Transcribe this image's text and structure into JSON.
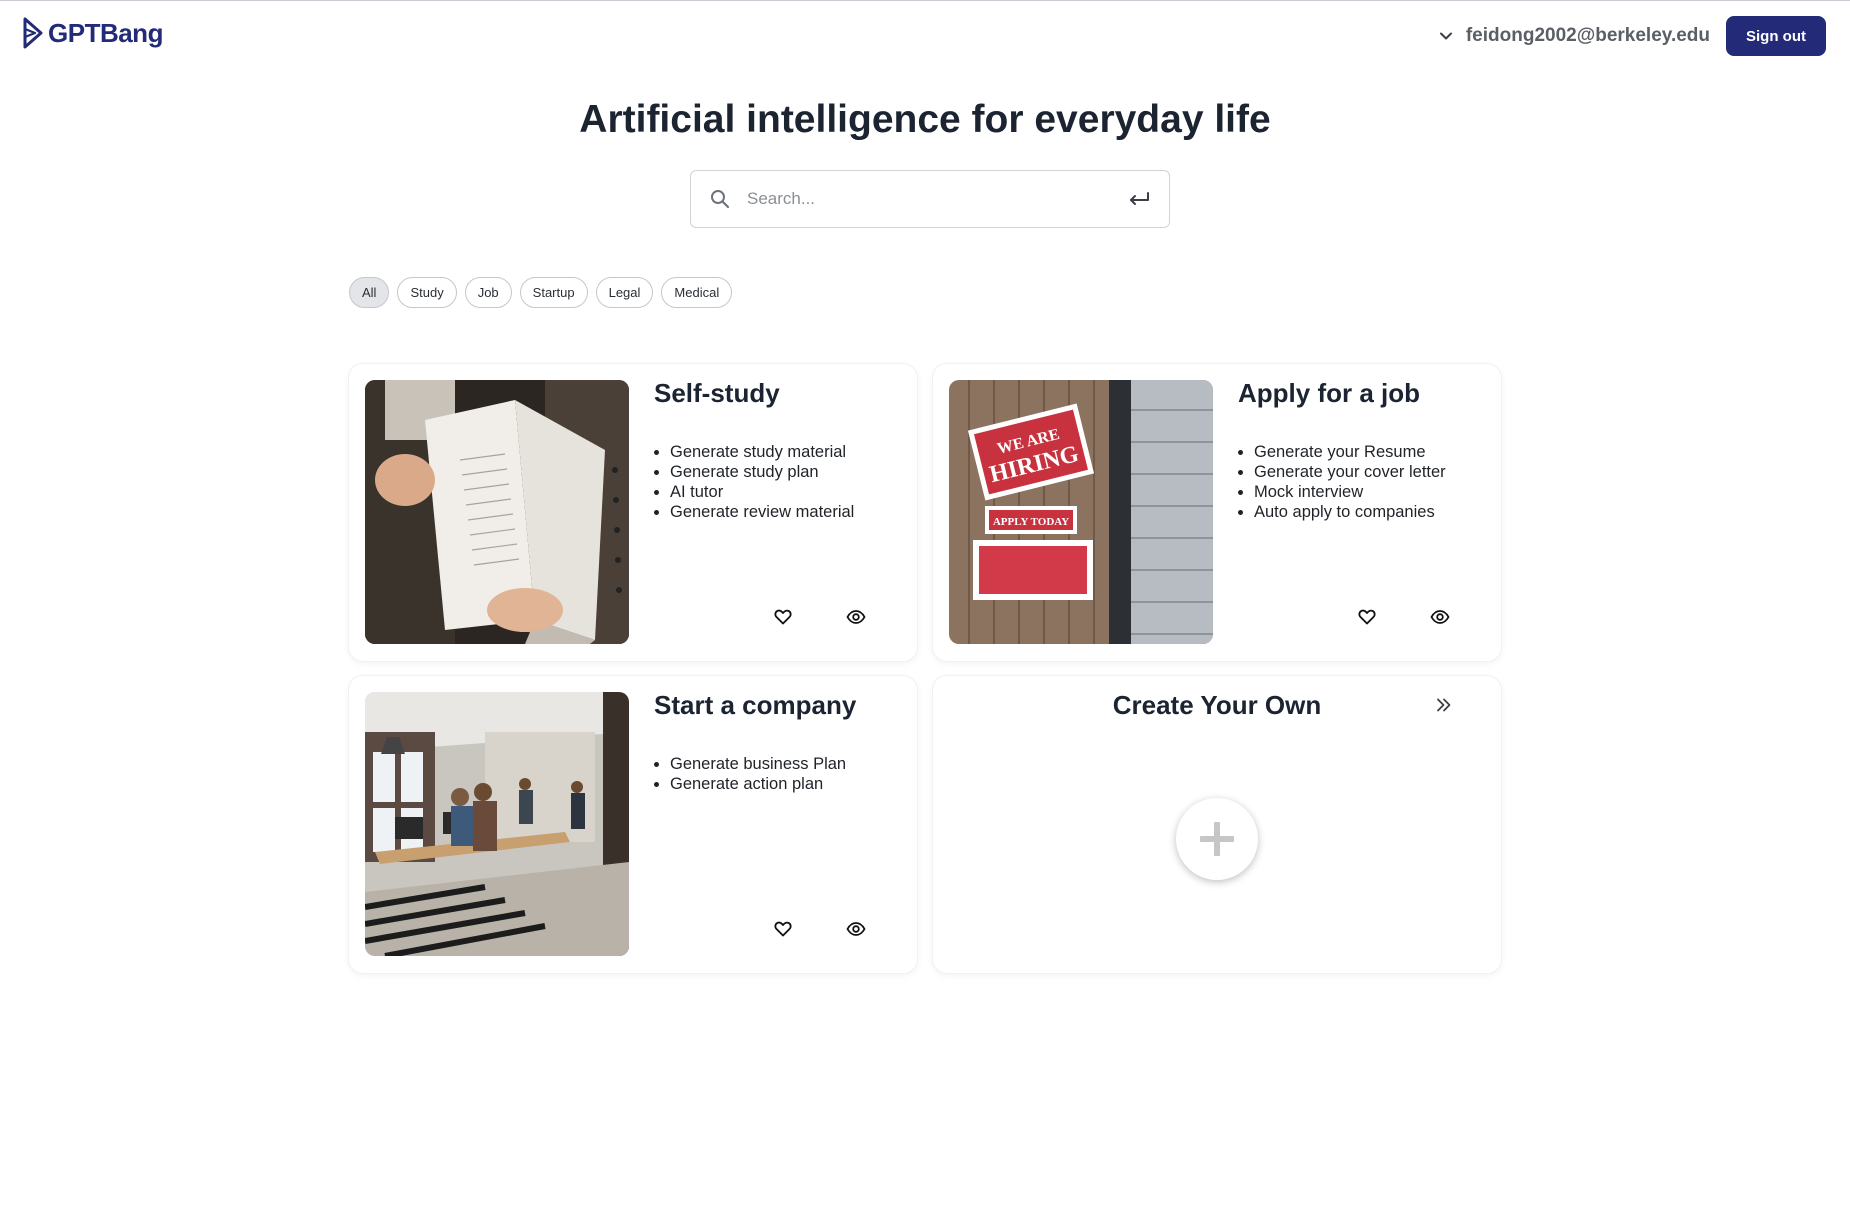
{
  "header": {
    "brand": "GPTBang",
    "user_email": "feidong2002@berkeley.edu",
    "signout_label": "Sign out"
  },
  "hero": {
    "title": "Artificial intelligence for everyday life"
  },
  "search": {
    "placeholder": "Search..."
  },
  "filters": [
    {
      "label": "All",
      "active": true
    },
    {
      "label": "Study",
      "active": false
    },
    {
      "label": "Job",
      "active": false
    },
    {
      "label": "Startup",
      "active": false
    },
    {
      "label": "Legal",
      "active": false
    },
    {
      "label": "Medical",
      "active": false
    }
  ],
  "cards": [
    {
      "title": "Self-study",
      "items": [
        "Generate study material",
        "Generate study plan",
        "AI tutor",
        "Generate review material"
      ]
    },
    {
      "title": "Apply for a job",
      "items": [
        "Generate your Resume",
        "Generate your cover letter",
        "Mock interview",
        "Auto apply to companies"
      ],
      "sign_text_1": "WE ARE",
      "sign_text_2": "HIRING",
      "sign_text_3": "APPLY TODAY"
    },
    {
      "title": "Start a company",
      "items": [
        "Generate business Plan",
        "Generate action plan"
      ]
    }
  ],
  "create_own": {
    "title": "Create Your Own"
  },
  "colors": {
    "brand": "#232a78",
    "text": "#1b2430",
    "chip_active_bg": "#e3e5e8"
  },
  "icons": [
    "logo-icon",
    "chevron-down-icon",
    "search-icon",
    "enter-icon",
    "heart-icon",
    "eye-icon",
    "double-chevron-right-icon",
    "plus-icon"
  ]
}
